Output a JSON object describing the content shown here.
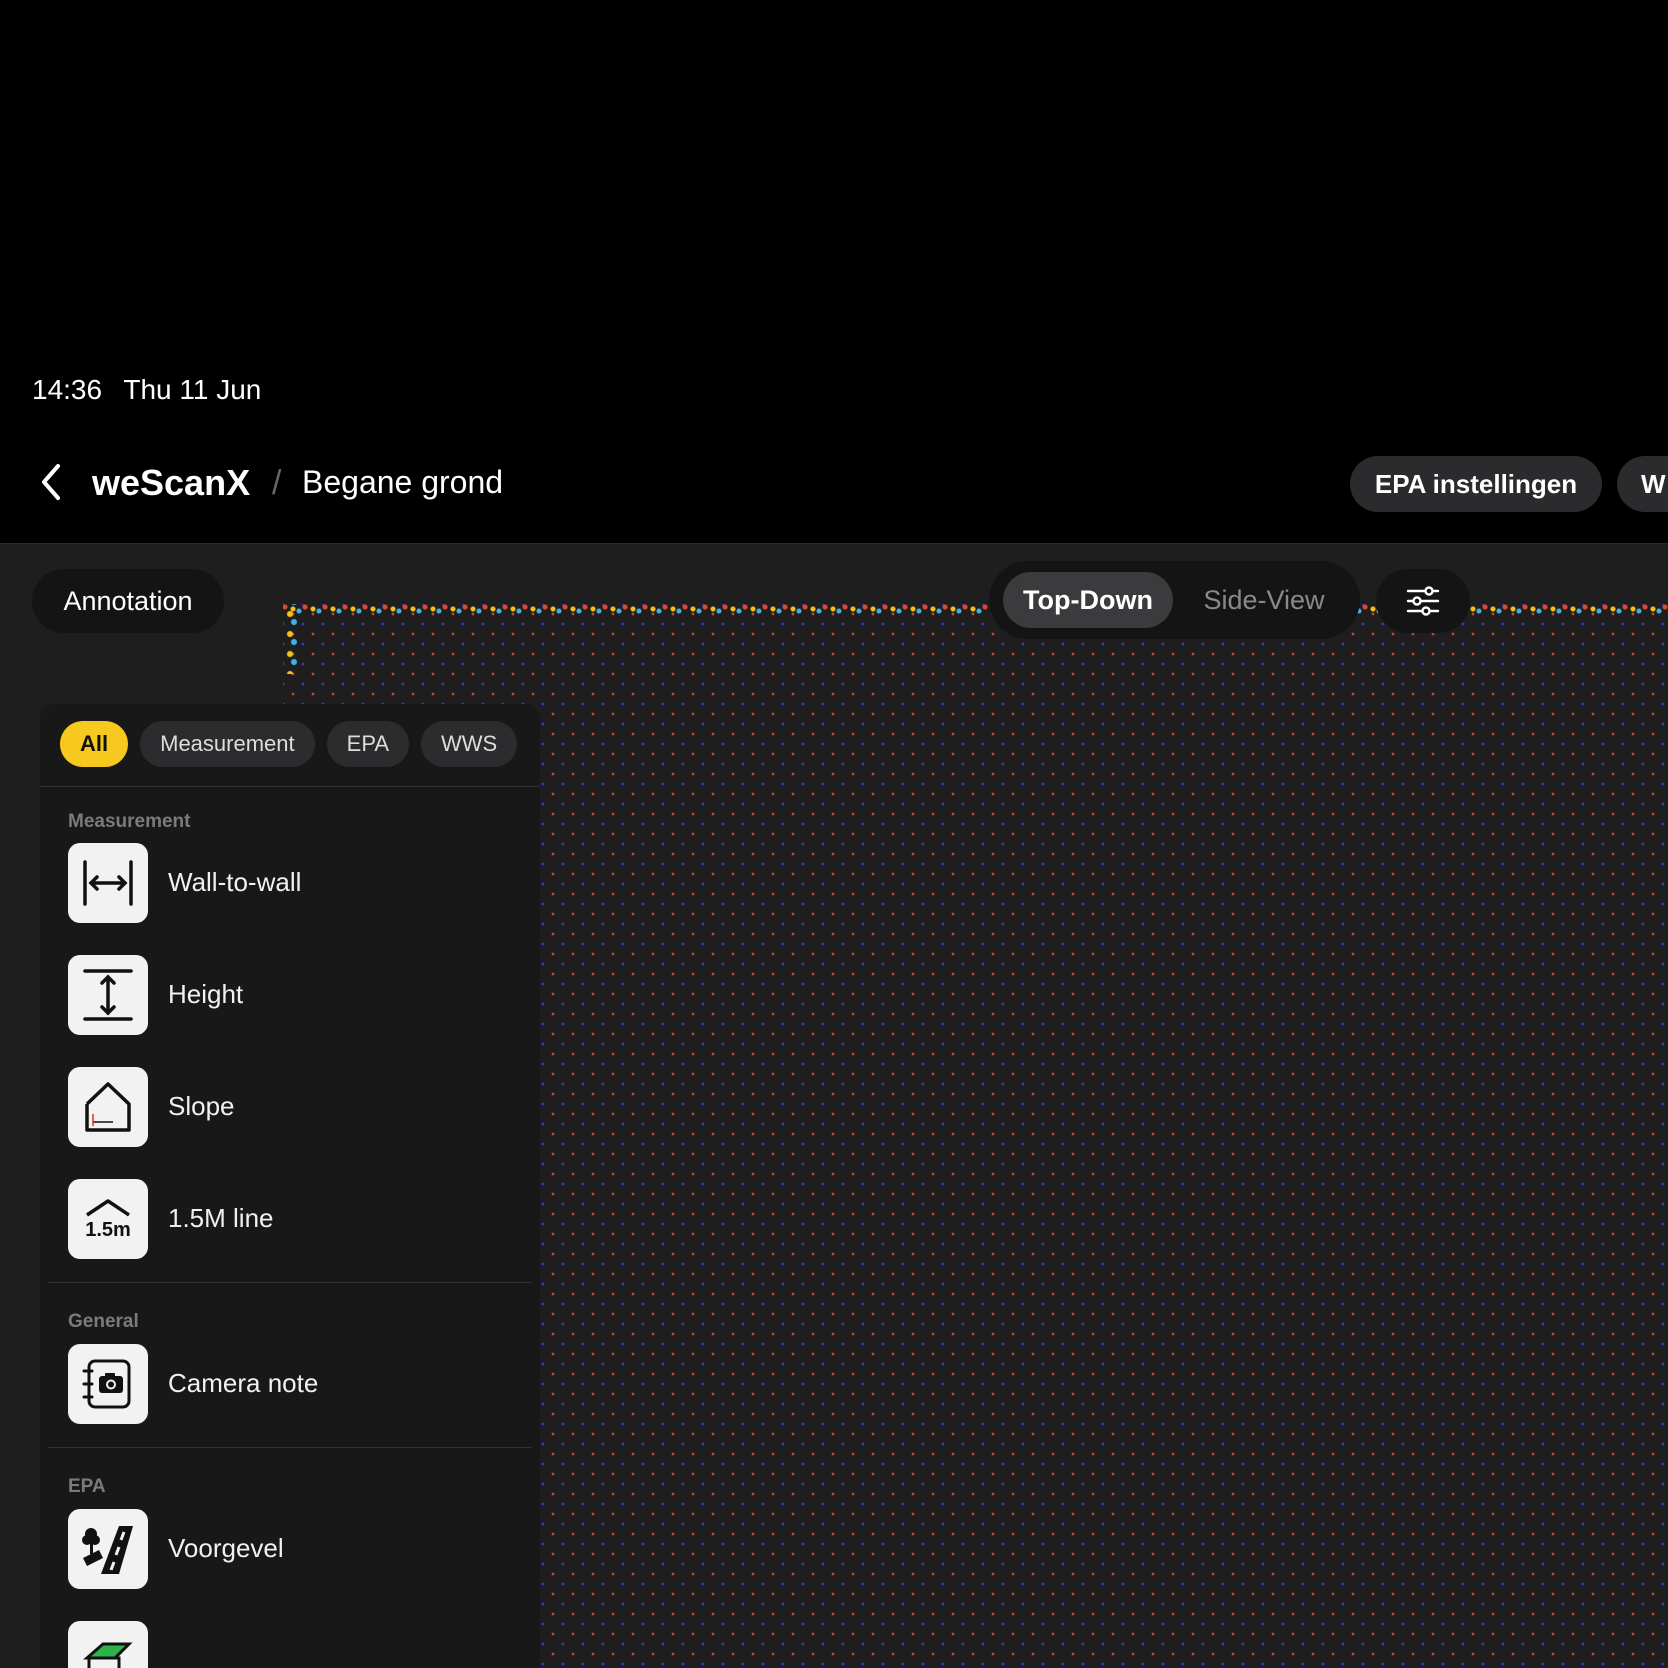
{
  "status": {
    "time": "14:36",
    "date": "Thu 11 Jun"
  },
  "nav": {
    "brand": "weScanX",
    "separator": "/",
    "crumb": "Begane grond",
    "epa_button": "EPA instellingen",
    "next_button": "W"
  },
  "toolbar": {
    "annotation": "Annotation",
    "view_top": "Top-Down",
    "view_side": "Side-View"
  },
  "panel": {
    "chips": [
      "All",
      "Measurement",
      "EPA",
      "WWS"
    ],
    "active_chip": "All",
    "sections": {
      "measurement": "Measurement",
      "general": "General",
      "epa": "EPA"
    },
    "tools": {
      "wall": "Wall-to-wall",
      "height": "Height",
      "slope": "Slope",
      "line": "1.5M line",
      "line_icon_text": "1.5m",
      "camera": "Camera note",
      "voorgevel": "Voorgevel"
    }
  },
  "colors": {
    "accent": "#f7c81d",
    "background": "#000000",
    "canvas": "#1e1e1f"
  }
}
